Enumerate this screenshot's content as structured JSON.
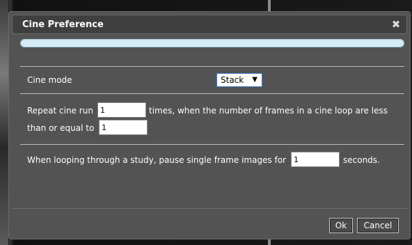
{
  "dialog": {
    "title": "Cine Preference",
    "close_icon": "close-icon",
    "progress": 1.0
  },
  "cine_mode": {
    "label": "Cine mode",
    "selected": "Stack",
    "arrow": "▼"
  },
  "repeat": {
    "text_before": "Repeat cine run",
    "runs_value": "1",
    "text_middle": "times, when the number of frames in a cine loop are less",
    "text_line2": "than or equal to",
    "frames_value": "1"
  },
  "pause": {
    "text_before": "When looping through a study, pause single frame images for",
    "seconds_value": "1",
    "text_after": "seconds."
  },
  "buttons": {
    "ok": "Ok",
    "cancel": "Cancel"
  },
  "colors": {
    "dialog_bg": "#535353",
    "titlebar_bg": "#3f3f3f",
    "progress": "#d4ecf6",
    "select_border": "#3f77c8"
  }
}
